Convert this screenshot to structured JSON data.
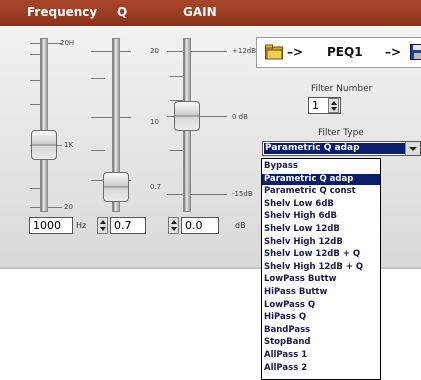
{
  "header": {
    "tab_frequency": "Frequency",
    "tab_q": "Q",
    "tab_gain": "GAIN"
  },
  "sliders": {
    "frequency": {
      "scale_top": "20H",
      "scale_mid": "1K",
      "scale_bottom": "20",
      "value": "1000",
      "unit": "Hz"
    },
    "q": {
      "scale_top": "20",
      "scale_mid": "10",
      "scale_bottom": "0.7",
      "value": "0.7"
    },
    "gain": {
      "scale_top": "+12dB",
      "scale_mid": "0 dB",
      "scale_bottom": "-15dB",
      "value": "0.0",
      "unit": "dB"
    }
  },
  "filter": {
    "arrow1": "–>",
    "name": "PEQ1",
    "arrow2": "–>",
    "number_label": "Filter Number",
    "number_value": "1",
    "type_label": "Filter Type",
    "selected_type": "Parametric Q adap",
    "options": [
      "Bypass",
      "Parametric Q adap",
      "Parametric Q const",
      "Shelv Low 6dB",
      "Shelv High 6dB",
      "Shelv Low 12dB",
      "Shelv High 12dB",
      "Shelv Low 12dB + Q",
      "Shelv High 12dB + Q",
      "LowPass Buttw",
      "HiPass Buttw",
      "LowPass Q",
      "HiPass Q",
      "BandPass",
      "StopBand",
      "AllPass 1",
      "AllPass 2"
    ]
  },
  "colors": {
    "header_bg": "#9a3b20",
    "selection": "#0a1f6b"
  }
}
